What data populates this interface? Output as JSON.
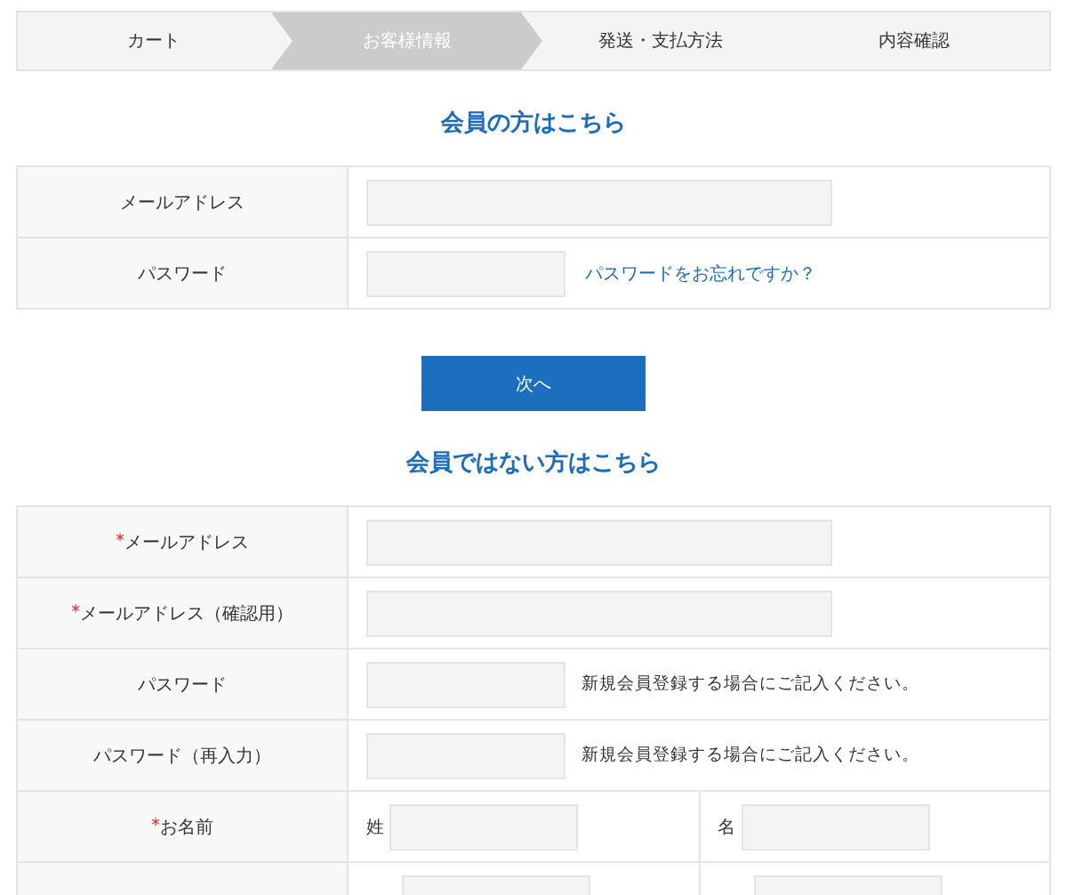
{
  "steps": [
    {
      "label": "カート",
      "selected": false
    },
    {
      "label": "お客様情報",
      "selected": true
    },
    {
      "label": "発送・支払方法",
      "selected": false
    },
    {
      "label": "内容確認",
      "selected": false
    }
  ],
  "member": {
    "heading": "会員の方はこちら",
    "rows": [
      {
        "label": "メールアドレス",
        "kind": "wide"
      },
      {
        "label": "パスワード",
        "kind": "short",
        "link": "パスワードをお忘れですか？"
      }
    ],
    "button": "次へ"
  },
  "guest": {
    "heading": "会員ではない方はこちら",
    "rows": [
      {
        "label": "メールアドレス",
        "mark": "*",
        "kind": "wide"
      },
      {
        "label": "メールアドレス（確認用）",
        "mark": "*",
        "kind": "wide"
      },
      {
        "label": "パスワード",
        "kind": "short",
        "note": "新規会員登録する場合にご記入ください。"
      },
      {
        "label": "パスワード（再入力）",
        "kind": "short",
        "note": "新規会員登録する場合にご記入ください。"
      },
      {
        "label": "お名前",
        "mark": "*",
        "kind": "split",
        "parts": [
          "姓",
          "名"
        ]
      },
      {
        "kind": "partial"
      }
    ]
  }
}
